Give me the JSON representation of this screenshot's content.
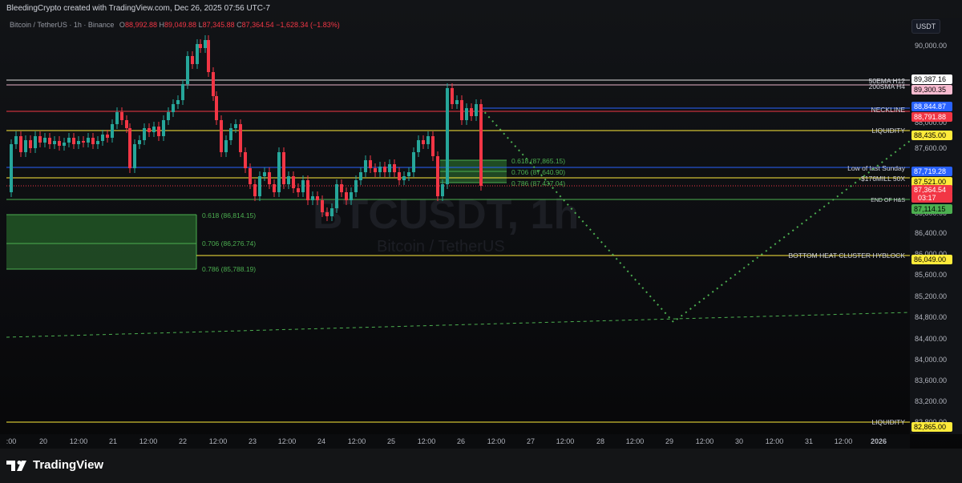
{
  "header": {
    "credit": "BleedingCrypto created with TradingView.com, Dec 26, 2025 07:56 UTC-7"
  },
  "legend": {
    "symbol": "Bitcoin / TetherUS · 1h · Binance",
    "open_label": "O",
    "open": "88,992.88",
    "high_label": "H",
    "high": "89,049.88",
    "low_label": "L",
    "low": "87,345.88",
    "close_label": "C",
    "close": "87,364.54",
    "change": "−1,628.34 (−1.83%)"
  },
  "watermark": {
    "symbol": "BTCUSDT, 1h",
    "name": "Bitcoin / TetherUS"
  },
  "price_axis": {
    "currency": "USDT",
    "ticks": [
      "90,000.00",
      "89,600.00",
      "88,800.00",
      "88,400.00",
      "88,000.00",
      "87,600.00",
      "86,800.00",
      "86,400.00",
      "86,000.00",
      "85,600.00",
      "85,200.00",
      "84,800.00",
      "84,400.00",
      "84,000.00",
      "83,600.00",
      "83,200.00",
      "82,800.00"
    ]
  },
  "time_axis": {
    "labels": [
      ":00",
      "20",
      "12:00",
      "21",
      "12:00",
      "22",
      "12:00",
      "23",
      "12:00",
      "24",
      "12:00",
      "25",
      "12:00",
      "26",
      "12:00",
      "27",
      "12:00",
      "28",
      "12:00",
      "29",
      "12:00",
      "30",
      "12:00",
      "31",
      "12:00",
      "2026"
    ]
  },
  "levels": [
    {
      "name": "50EMA H12",
      "price": "89,387.16",
      "color": "#ffffff",
      "text_color": "#000000"
    },
    {
      "name": "200SMA H4",
      "price": "89,300.35",
      "color": "#f8bbd0",
      "text_color": "#000000"
    },
    {
      "name": "",
      "price": "88,844.87",
      "color": "#2962ff",
      "text_color": "#ffffff"
    },
    {
      "name": "NECKLINE",
      "price": "88,791.88",
      "color": "#f23645",
      "text_color": "#ffffff"
    },
    {
      "name": "LIQUIDITY",
      "price": "88,435.00",
      "color": "#ffeb3b",
      "text_color": "#000000"
    },
    {
      "name": "Low of last Sunday",
      "price": "87,719.28",
      "color": "#2962ff",
      "text_color": "#ffffff"
    },
    {
      "name": "$176MILL 50X",
      "price": "87,521.00",
      "color": "#ffeb3b",
      "text_color": "#000000"
    },
    {
      "name": "",
      "price": "87,364.54",
      "countdown": "03:17",
      "color": "#f23645",
      "text_color": "#ffffff"
    },
    {
      "name": "END OF H&S",
      "price": "87,114.15",
      "color": "#4caf50",
      "text_color": "#000000"
    },
    {
      "name": "BOTTOM HEAT CLUSTER HYBLOCK",
      "price": "86,049.00",
      "color": "#ffeb3b",
      "text_color": "#000000"
    },
    {
      "name": "LIQUIDITY",
      "price": "82,865.00",
      "color": "#ffeb3b",
      "text_color": "#000000"
    }
  ],
  "fib_upper": [
    {
      "label": "0.618 (87,865.15)"
    },
    {
      "label": "0.706 (87,640.90)"
    },
    {
      "label": "0.786 (87,437.04)"
    }
  ],
  "fib_lower": [
    {
      "label": "0.618 (86,814.15)"
    },
    {
      "label": "0.706 (86,276.74)"
    },
    {
      "label": "0.786 (85,788.19)"
    }
  ],
  "footer": {
    "brand": "TradingView"
  },
  "colors": {
    "up": "#26a69a",
    "down": "#f23645",
    "projection": "#4caf50"
  }
}
